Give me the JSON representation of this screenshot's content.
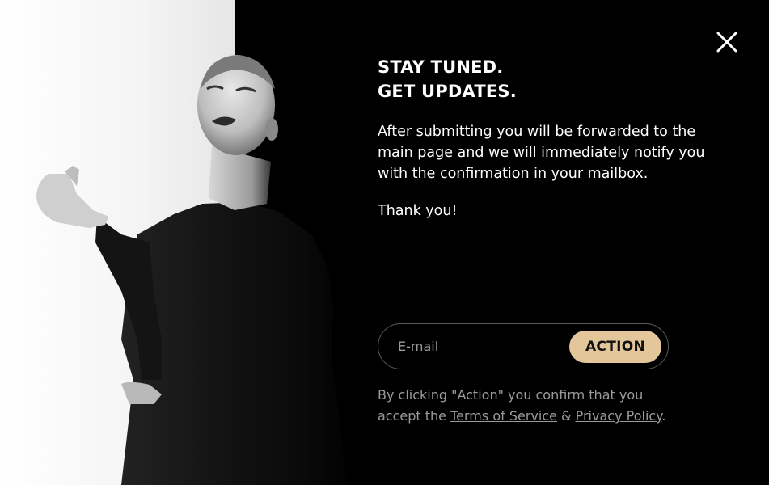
{
  "modal": {
    "headline_line1": "STAY TUNED.",
    "headline_line2": "GET UPDATES.",
    "description": "After submitting you will be forwarded to the main page and we will immediately notify you with the confirmation in your mailbox.",
    "thanks": "Thank you!"
  },
  "form": {
    "email_placeholder": "E-mail",
    "action_label": "ACTION"
  },
  "legal": {
    "prefix": "By clicking \"Action\" you confirm that you accept the ",
    "terms_label": "Terms of Service",
    "separator": " & ",
    "privacy_label": "Privacy Policy",
    "suffix": "."
  },
  "icons": {
    "close": "close-icon"
  },
  "colors": {
    "background": "#000000",
    "accent": "#e3c79a",
    "text": "#ffffff",
    "muted": "#9a9a9a"
  }
}
